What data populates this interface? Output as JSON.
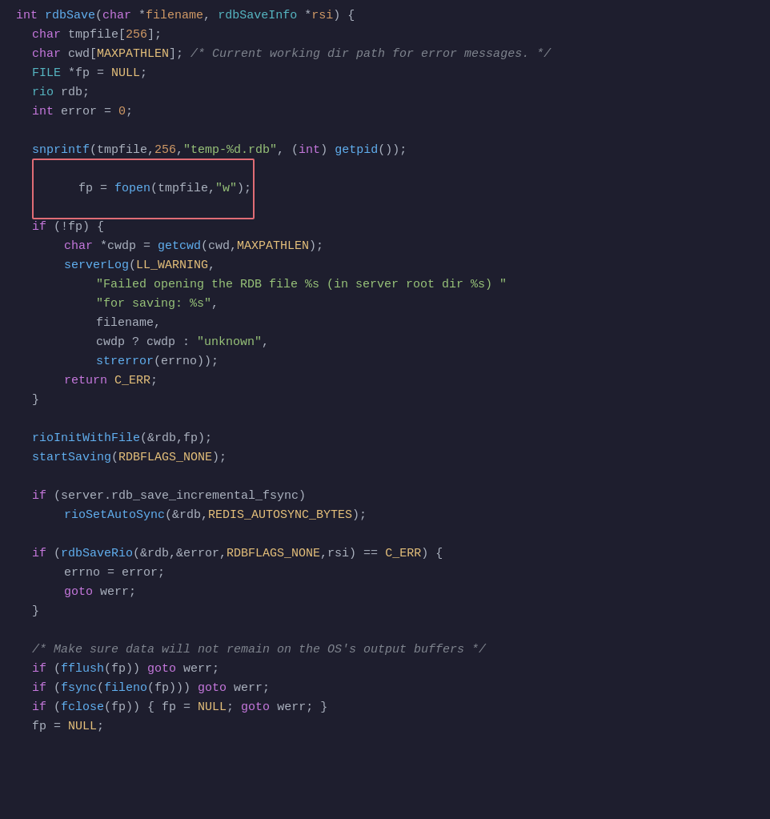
{
  "editor": {
    "background": "#1e1e2e",
    "lines": [
      {
        "id": 1,
        "indent": 0,
        "content": "func_signature"
      },
      {
        "id": 2,
        "indent": 1,
        "content": "char_tmpfile"
      },
      {
        "id": 3,
        "indent": 1,
        "content": "char_cwd"
      },
      {
        "id": 4,
        "indent": 1,
        "content": "file_fp"
      },
      {
        "id": 5,
        "indent": 1,
        "content": "rio_rdb"
      },
      {
        "id": 6,
        "indent": 1,
        "content": "int_error"
      },
      {
        "id": 7,
        "indent": 0,
        "content": "blank"
      },
      {
        "id": 8,
        "indent": 1,
        "content": "snprintf_call"
      },
      {
        "id": 9,
        "indent": 1,
        "content": "fp_assign",
        "highlighted": true
      },
      {
        "id": 10,
        "indent": 1,
        "content": "if_fp"
      },
      {
        "id": 11,
        "indent": 2,
        "content": "char_cwdp"
      },
      {
        "id": 12,
        "indent": 2,
        "content": "serverlog"
      },
      {
        "id": 13,
        "indent": 3,
        "content": "str_failed"
      },
      {
        "id": 14,
        "indent": 3,
        "content": "str_for_saving"
      },
      {
        "id": 15,
        "indent": 3,
        "content": "filename_arg"
      },
      {
        "id": 16,
        "indent": 3,
        "content": "cwdp_ternary"
      },
      {
        "id": 17,
        "indent": 3,
        "content": "strerror_arg"
      },
      {
        "id": 18,
        "indent": 2,
        "content": "return_cerr"
      },
      {
        "id": 19,
        "indent": 1,
        "content": "close_brace"
      },
      {
        "id": 20,
        "indent": 0,
        "content": "blank"
      },
      {
        "id": 21,
        "indent": 1,
        "content": "rioInit"
      },
      {
        "id": 22,
        "indent": 1,
        "content": "startSaving"
      },
      {
        "id": 23,
        "indent": 0,
        "content": "blank"
      },
      {
        "id": 24,
        "indent": 1,
        "content": "if_server_fsync"
      },
      {
        "id": 25,
        "indent": 2,
        "content": "rioSetAutoSync"
      },
      {
        "id": 26,
        "indent": 0,
        "content": "blank"
      },
      {
        "id": 27,
        "indent": 1,
        "content": "if_rdbSaveRio"
      },
      {
        "id": 28,
        "indent": 2,
        "content": "errno_assign"
      },
      {
        "id": 29,
        "indent": 2,
        "content": "goto_werr"
      },
      {
        "id": 30,
        "indent": 1,
        "content": "close_brace"
      },
      {
        "id": 31,
        "indent": 0,
        "content": "blank"
      },
      {
        "id": 32,
        "indent": 1,
        "content": "comment_make_sure"
      },
      {
        "id": 33,
        "indent": 1,
        "content": "if_fflush"
      },
      {
        "id": 34,
        "indent": 1,
        "content": "if_fsync"
      },
      {
        "id": 35,
        "indent": 1,
        "content": "if_fclose"
      },
      {
        "id": 36,
        "indent": 1,
        "content": "fp_null"
      }
    ]
  }
}
